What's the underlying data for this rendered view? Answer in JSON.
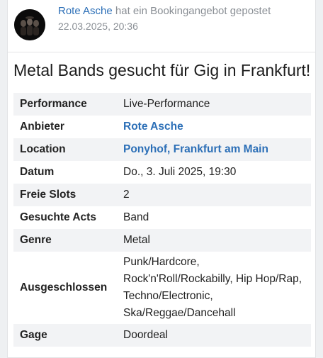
{
  "post": {
    "author": "Rote Asche",
    "action": "hat ein Bookingangebot gepostet",
    "timestamp": "22.03.2025, 20:36"
  },
  "offer": {
    "title": "Metal Bands gesucht für Gig in Frankfurt!",
    "rows": [
      {
        "label": "Performance",
        "value": "Live-Performance"
      },
      {
        "label": "Anbieter",
        "value": "Rote Asche"
      },
      {
        "label": "Location",
        "value": "Ponyhof, Frankfurt am Main"
      },
      {
        "label": "Datum",
        "value": "Do., 3. Juli 2025, 19:30"
      },
      {
        "label": "Freie Slots",
        "value": "2"
      },
      {
        "label": "Gesuchte Acts",
        "value": "Band"
      },
      {
        "label": "Genre",
        "value": "Metal"
      },
      {
        "label": "Ausgeschlossen",
        "value": "Punk/Hardcore, Rock'n'Roll/Rockabilly, Hip Hop/Rap, Techno/Electronic, Ska/Reggae/Dancehall"
      },
      {
        "label": "Gage",
        "value": "Doordeal"
      }
    ]
  },
  "colors": {
    "link": "#2c6fb7",
    "muted": "#8a8f95",
    "row_alt": "#f2f3f5"
  }
}
